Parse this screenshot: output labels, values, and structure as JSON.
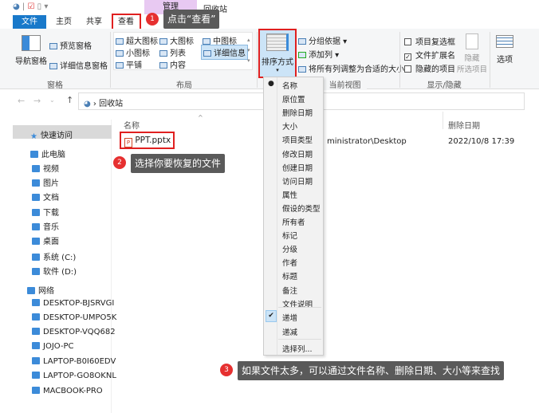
{
  "titlebar": {
    "context_tab": "管理",
    "title": "回收站"
  },
  "tabs": [
    "文件",
    "主页",
    "共享",
    "查看"
  ],
  "ribbon": {
    "pane": {
      "nav_pane": "导航窗格",
      "preview_pane": "预览窗格",
      "details_pane": "详细信息窗格",
      "group": "窗格"
    },
    "layout": {
      "items": [
        "超大图标",
        "大图标",
        "中图标",
        "小图标",
        "列表",
        "详细信息",
        "平铺",
        "内容"
      ],
      "group": "布局"
    },
    "current_view": {
      "sort_by": "排序方式",
      "group_by": "分组依据",
      "add_column": "添加列",
      "fit_columns": "将所有列调整为合适的大小",
      "group": "当前视图"
    },
    "show_hide": {
      "item_checkboxes": "项目复选框",
      "item_checkboxes_checked": false,
      "file_ext": "文件扩展名",
      "file_ext_checked": true,
      "hidden_items": "隐藏的项目",
      "hidden_items_checked": false,
      "hide_selected_1": "隐藏",
      "hide_selected_2": "所选项目",
      "group": "显示/隐藏"
    },
    "options": "选项"
  },
  "address": {
    "path": "回收站"
  },
  "columns": {
    "name": "名称",
    "date_deleted": "删除日期"
  },
  "file": {
    "name": "PPT.pptx",
    "location": "ministrator\\Desktop",
    "date": "2022/10/8 17:39"
  },
  "sidebar": [
    "快速访问",
    "此电脑",
    "视频",
    "图片",
    "文档",
    "下载",
    "音乐",
    "桌面",
    "系统 (C:)",
    "软件 (D:)",
    "网络",
    "DESKTOP-BJSRVGI",
    "DESKTOP-UMPO5K",
    "DESKTOP-VQQ682",
    "JOJO-PC",
    "LAPTOP-B0I60EDV",
    "LAPTOP-GO8OKNL",
    "MACBOOK-PRO"
  ],
  "sort_menu": {
    "items": [
      "名称",
      "原位置",
      "删除日期",
      "大小",
      "项目类型",
      "修改日期",
      "创建日期",
      "访问日期",
      "属性",
      "假设的类型",
      "所有者",
      "标记",
      "分级",
      "作者",
      "标题",
      "备注",
      "文件说明"
    ],
    "selected": "名称",
    "ascending": "递增",
    "descending": "递减",
    "choose_columns": "选择列..."
  },
  "steps": [
    {
      "num": "1",
      "text": "点击“查看”"
    },
    {
      "num": "2",
      "text": "选择你要恢复的文件"
    },
    {
      "num": "3",
      "text": "如果文件太多，可以通过文件名称、删除日期、大小等来查找"
    }
  ],
  "colors": {
    "accent": "#1979ca",
    "highlight": "#e02020",
    "tooltip": "#5a5a5a"
  }
}
